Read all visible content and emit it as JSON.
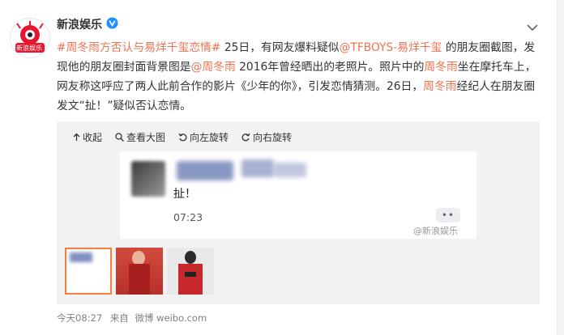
{
  "account": {
    "name": "新浪娱乐",
    "logo_text": "新浪娱乐"
  },
  "post": {
    "parts": [
      {
        "t": "#周冬雨方否认与易烊千玺恋情#",
        "c": "orange"
      },
      {
        "t": " 25日，有网友爆料疑似",
        "c": "plain"
      },
      {
        "t": "@TFBOYS-易烊千玺",
        "c": "orange"
      },
      {
        "t": " 的朋友圈截图，发现他的朋友圈封面背景图是",
        "c": "plain"
      },
      {
        "t": "@周冬雨",
        "c": "orange"
      },
      {
        "t": " 2016年曾经晒出的老照片。照片中的",
        "c": "plain"
      },
      {
        "t": "周冬雨",
        "c": "orange"
      },
      {
        "t": "坐在摩托车上，网友称这呼应了两人此前合作的影片《少年的你》，引发恋情猜测。26日，",
        "c": "plain"
      },
      {
        "t": "周冬雨",
        "c": "orange"
      },
      {
        "t": "经纪人在朋友圈发文“扯！”疑似否认恋情。",
        "c": "plain"
      }
    ]
  },
  "toolbar": {
    "collapse": "收起",
    "view_large": "查看大图",
    "rotate_left": "向左旋转",
    "rotate_right": "向右旋转"
  },
  "image": {
    "message": "扯！",
    "time": "07:23",
    "more": "••",
    "watermark": "@新浪娱乐"
  },
  "footer": {
    "time": "今天08:27",
    "source_prefix": "来自",
    "source": "微博 weibo.com"
  },
  "colors": {
    "orange": "#eb7350",
    "selected_border": "#fa7d3c",
    "verified": "#1e90ff"
  }
}
